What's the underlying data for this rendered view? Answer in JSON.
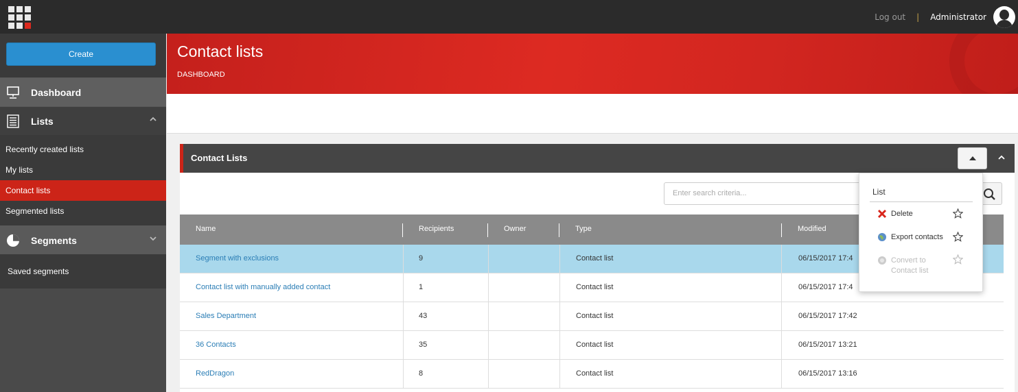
{
  "topbar": {
    "logout": "Log out",
    "separator": "|",
    "user": "Administrator"
  },
  "sidebar": {
    "create": "Create",
    "dashboard": "Dashboard",
    "lists": "Lists",
    "list_items": [
      "Recently created lists",
      "My lists",
      "Contact lists",
      "Segmented lists"
    ],
    "segments": "Segments",
    "segment_items": [
      "Saved segments"
    ]
  },
  "header": {
    "title": "Contact lists",
    "breadcrumb": "DASHBOARD"
  },
  "panel": {
    "title": "Contact Lists",
    "search_placeholder": "Enter search criteria...",
    "columns": [
      "Name",
      "Recipients",
      "Owner",
      "Type",
      "Modified"
    ],
    "rows": [
      {
        "name": "Segment with exclusions",
        "recipients": "9",
        "owner": "",
        "type": "Contact list",
        "modified": "06/15/2017 17:4"
      },
      {
        "name": "Contact list with manually added contact",
        "recipients": "1",
        "owner": "",
        "type": "Contact list",
        "modified": "06/15/2017 17:4"
      },
      {
        "name": "Sales Department",
        "recipients": "43",
        "owner": "",
        "type": "Contact list",
        "modified": "06/15/2017 17:42"
      },
      {
        "name": "36 Contacts",
        "recipients": "35",
        "owner": "",
        "type": "Contact list",
        "modified": "06/15/2017 13:21"
      },
      {
        "name": "RedDragon",
        "recipients": "8",
        "owner": "",
        "type": "Contact list",
        "modified": "06/15/2017 13:16"
      }
    ]
  },
  "dropdown": {
    "title": "List",
    "items": [
      {
        "label": "Delete",
        "icon": "delete-x-icon",
        "enabled": true
      },
      {
        "label": "Export contacts",
        "icon": "globe-export-icon",
        "enabled": true
      },
      {
        "label": "Convert to Contact list",
        "line1": "Convert to",
        "line2": "Contact list",
        "icon": "convert-icon",
        "enabled": false
      }
    ]
  },
  "colors": {
    "brand_red": "#cc2418",
    "button_blue": "#2a8fd0",
    "selected_row": "#a9d8ec",
    "link": "#2a7db5"
  }
}
